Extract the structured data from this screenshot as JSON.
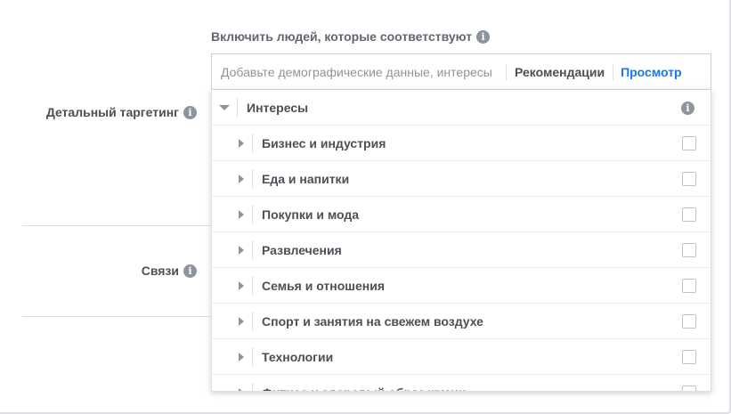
{
  "targeting": {
    "include_label": "Включить людей, которые соответствуют",
    "search_placeholder": "Добавьте демографические данные, интересы",
    "recommendations_label": "Рекомендации",
    "browse_label": "Просмотр"
  },
  "rows": {
    "detailed_targeting_label": "Детальный таргетинг",
    "connections_label": "Связи"
  },
  "dropdown": {
    "header_label": "Интересы",
    "items": [
      {
        "label": "Бизнес и индустрия"
      },
      {
        "label": "Еда и напитки"
      },
      {
        "label": "Покупки и мода"
      },
      {
        "label": "Развлечения"
      },
      {
        "label": "Семья и отношения"
      },
      {
        "label": "Спорт и занятия на свежем воздухе"
      },
      {
        "label": "Технологии"
      },
      {
        "label": "Фитнес и здоровый образ жизни"
      }
    ]
  },
  "colors": {
    "accent": "#1877f2",
    "text": "#4b4f56",
    "info_icon": "#8d949e",
    "border": "#dddfe2"
  },
  "icons": {
    "info": "info-icon",
    "expand": "triangle-down-icon",
    "collapsed": "triangle-right-icon",
    "checkbox": "checkbox-empty"
  }
}
